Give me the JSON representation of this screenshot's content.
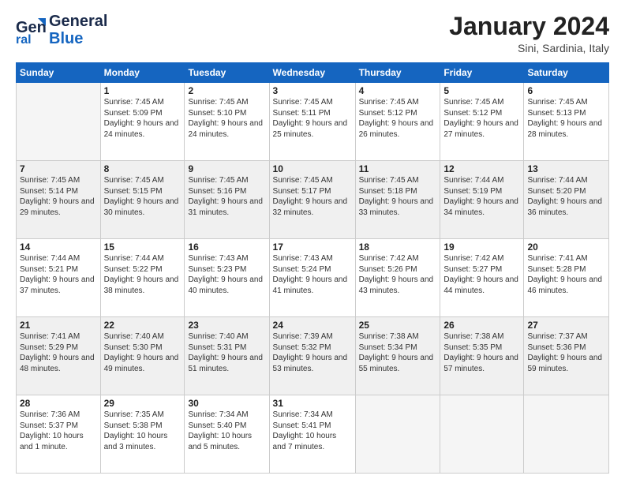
{
  "logo": {
    "line1": "General",
    "line2": "Blue"
  },
  "header": {
    "title": "January 2024",
    "subtitle": "Sini, Sardinia, Italy"
  },
  "days_of_week": [
    "Sunday",
    "Monday",
    "Tuesday",
    "Wednesday",
    "Thursday",
    "Friday",
    "Saturday"
  ],
  "weeks": [
    [
      {
        "day": "",
        "sunrise": "",
        "sunset": "",
        "daylight": ""
      },
      {
        "day": "1",
        "sunrise": "Sunrise: 7:45 AM",
        "sunset": "Sunset: 5:09 PM",
        "daylight": "Daylight: 9 hours and 24 minutes."
      },
      {
        "day": "2",
        "sunrise": "Sunrise: 7:45 AM",
        "sunset": "Sunset: 5:10 PM",
        "daylight": "Daylight: 9 hours and 24 minutes."
      },
      {
        "day": "3",
        "sunrise": "Sunrise: 7:45 AM",
        "sunset": "Sunset: 5:11 PM",
        "daylight": "Daylight: 9 hours and 25 minutes."
      },
      {
        "day": "4",
        "sunrise": "Sunrise: 7:45 AM",
        "sunset": "Sunset: 5:12 PM",
        "daylight": "Daylight: 9 hours and 26 minutes."
      },
      {
        "day": "5",
        "sunrise": "Sunrise: 7:45 AM",
        "sunset": "Sunset: 5:12 PM",
        "daylight": "Daylight: 9 hours and 27 minutes."
      },
      {
        "day": "6",
        "sunrise": "Sunrise: 7:45 AM",
        "sunset": "Sunset: 5:13 PM",
        "daylight": "Daylight: 9 hours and 28 minutes."
      }
    ],
    [
      {
        "day": "7",
        "sunrise": "Sunrise: 7:45 AM",
        "sunset": "Sunset: 5:14 PM",
        "daylight": "Daylight: 9 hours and 29 minutes."
      },
      {
        "day": "8",
        "sunrise": "Sunrise: 7:45 AM",
        "sunset": "Sunset: 5:15 PM",
        "daylight": "Daylight: 9 hours and 30 minutes."
      },
      {
        "day": "9",
        "sunrise": "Sunrise: 7:45 AM",
        "sunset": "Sunset: 5:16 PM",
        "daylight": "Daylight: 9 hours and 31 minutes."
      },
      {
        "day": "10",
        "sunrise": "Sunrise: 7:45 AM",
        "sunset": "Sunset: 5:17 PM",
        "daylight": "Daylight: 9 hours and 32 minutes."
      },
      {
        "day": "11",
        "sunrise": "Sunrise: 7:45 AM",
        "sunset": "Sunset: 5:18 PM",
        "daylight": "Daylight: 9 hours and 33 minutes."
      },
      {
        "day": "12",
        "sunrise": "Sunrise: 7:44 AM",
        "sunset": "Sunset: 5:19 PM",
        "daylight": "Daylight: 9 hours and 34 minutes."
      },
      {
        "day": "13",
        "sunrise": "Sunrise: 7:44 AM",
        "sunset": "Sunset: 5:20 PM",
        "daylight": "Daylight: 9 hours and 36 minutes."
      }
    ],
    [
      {
        "day": "14",
        "sunrise": "Sunrise: 7:44 AM",
        "sunset": "Sunset: 5:21 PM",
        "daylight": "Daylight: 9 hours and 37 minutes."
      },
      {
        "day": "15",
        "sunrise": "Sunrise: 7:44 AM",
        "sunset": "Sunset: 5:22 PM",
        "daylight": "Daylight: 9 hours and 38 minutes."
      },
      {
        "day": "16",
        "sunrise": "Sunrise: 7:43 AM",
        "sunset": "Sunset: 5:23 PM",
        "daylight": "Daylight: 9 hours and 40 minutes."
      },
      {
        "day": "17",
        "sunrise": "Sunrise: 7:43 AM",
        "sunset": "Sunset: 5:24 PM",
        "daylight": "Daylight: 9 hours and 41 minutes."
      },
      {
        "day": "18",
        "sunrise": "Sunrise: 7:42 AM",
        "sunset": "Sunset: 5:26 PM",
        "daylight": "Daylight: 9 hours and 43 minutes."
      },
      {
        "day": "19",
        "sunrise": "Sunrise: 7:42 AM",
        "sunset": "Sunset: 5:27 PM",
        "daylight": "Daylight: 9 hours and 44 minutes."
      },
      {
        "day": "20",
        "sunrise": "Sunrise: 7:41 AM",
        "sunset": "Sunset: 5:28 PM",
        "daylight": "Daylight: 9 hours and 46 minutes."
      }
    ],
    [
      {
        "day": "21",
        "sunrise": "Sunrise: 7:41 AM",
        "sunset": "Sunset: 5:29 PM",
        "daylight": "Daylight: 9 hours and 48 minutes."
      },
      {
        "day": "22",
        "sunrise": "Sunrise: 7:40 AM",
        "sunset": "Sunset: 5:30 PM",
        "daylight": "Daylight: 9 hours and 49 minutes."
      },
      {
        "day": "23",
        "sunrise": "Sunrise: 7:40 AM",
        "sunset": "Sunset: 5:31 PM",
        "daylight": "Daylight: 9 hours and 51 minutes."
      },
      {
        "day": "24",
        "sunrise": "Sunrise: 7:39 AM",
        "sunset": "Sunset: 5:32 PM",
        "daylight": "Daylight: 9 hours and 53 minutes."
      },
      {
        "day": "25",
        "sunrise": "Sunrise: 7:38 AM",
        "sunset": "Sunset: 5:34 PM",
        "daylight": "Daylight: 9 hours and 55 minutes."
      },
      {
        "day": "26",
        "sunrise": "Sunrise: 7:38 AM",
        "sunset": "Sunset: 5:35 PM",
        "daylight": "Daylight: 9 hours and 57 minutes."
      },
      {
        "day": "27",
        "sunrise": "Sunrise: 7:37 AM",
        "sunset": "Sunset: 5:36 PM",
        "daylight": "Daylight: 9 hours and 59 minutes."
      }
    ],
    [
      {
        "day": "28",
        "sunrise": "Sunrise: 7:36 AM",
        "sunset": "Sunset: 5:37 PM",
        "daylight": "Daylight: 10 hours and 1 minute."
      },
      {
        "day": "29",
        "sunrise": "Sunrise: 7:35 AM",
        "sunset": "Sunset: 5:38 PM",
        "daylight": "Daylight: 10 hours and 3 minutes."
      },
      {
        "day": "30",
        "sunrise": "Sunrise: 7:34 AM",
        "sunset": "Sunset: 5:40 PM",
        "daylight": "Daylight: 10 hours and 5 minutes."
      },
      {
        "day": "31",
        "sunrise": "Sunrise: 7:34 AM",
        "sunset": "Sunset: 5:41 PM",
        "daylight": "Daylight: 10 hours and 7 minutes."
      },
      {
        "day": "",
        "sunrise": "",
        "sunset": "",
        "daylight": ""
      },
      {
        "day": "",
        "sunrise": "",
        "sunset": "",
        "daylight": ""
      },
      {
        "day": "",
        "sunrise": "",
        "sunset": "",
        "daylight": ""
      }
    ]
  ]
}
